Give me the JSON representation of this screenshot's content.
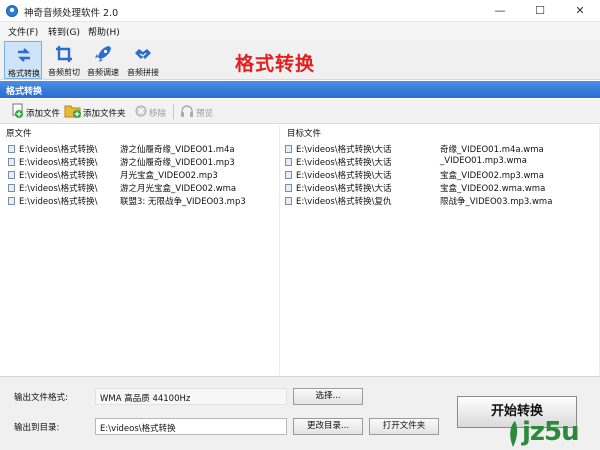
{
  "window": {
    "title": "神奇音频处理软件 2.0",
    "min": "—",
    "max": "☐",
    "close": "✕"
  },
  "menu": [
    "文件(F)",
    "转到(G)",
    "帮助(H)"
  ],
  "toolbar": {
    "tools": [
      "格式转换",
      "音频剪切",
      "音频调速",
      "音频拼接"
    ],
    "active": "格式转换",
    "big_title": "格式转换"
  },
  "section_title": "格式转换",
  "actions": {
    "add_file": "添加文件",
    "add_folder": "添加文件夹",
    "remove": "移除",
    "preview": "预览"
  },
  "source": {
    "header": "原文件",
    "files": [
      "E:\\videos\\格式转换\\",
      "E:\\videos\\格式转换\\",
      "E:\\videos\\格式转换\\",
      "E:\\videos\\格式转换\\",
      "E:\\videos\\格式转换\\"
    ],
    "suffixes": [
      "游之仙履奇缘_VIDEO01.m4a",
      "游之仙履奇缘_VIDEO01.mp3",
      "月光宝盒_VIDEO02.mp3",
      "游之月光宝盒_VIDEO02.wma",
      "联盟3: 无限战争_VIDEO03.mp3"
    ]
  },
  "target": {
    "header": "目标文件",
    "prefixes": [
      "E:\\videos\\格式转换\\大话",
      "E:\\videos\\格式转换\\大话",
      "E:\\videos\\格式转换\\大话",
      "E:\\videos\\格式转换\\大话",
      "E:\\videos\\格式转换\\复仇"
    ],
    "suffixes": [
      "奇缘_VIDEO01.m4a.wma",
      "_VIDEO01.mp3.wma",
      "宝盒_VIDEO02.mp3.wma",
      "宝盒_VIDEO02.wma.wma",
      "限战争_VIDEO03.mp3.wma"
    ]
  },
  "output": {
    "format_label": "输出文件格式:",
    "format_value": "WMA 高品质 44100Hz",
    "select_btn": "选择...",
    "dir_label": "输出到目录:",
    "dir_value": "E:\\videos\\格式转换",
    "change_dir_btn": "更改目录...",
    "open_folder_btn": "打开文件夹"
  },
  "start_button": "开始转换",
  "watermark": {
    "text": "jz5u",
    "color": "#2d8a3a"
  },
  "colors": {
    "accent": "#2a6cd1",
    "title_red": "#e02020",
    "active_tool": "#cfe4f8"
  }
}
